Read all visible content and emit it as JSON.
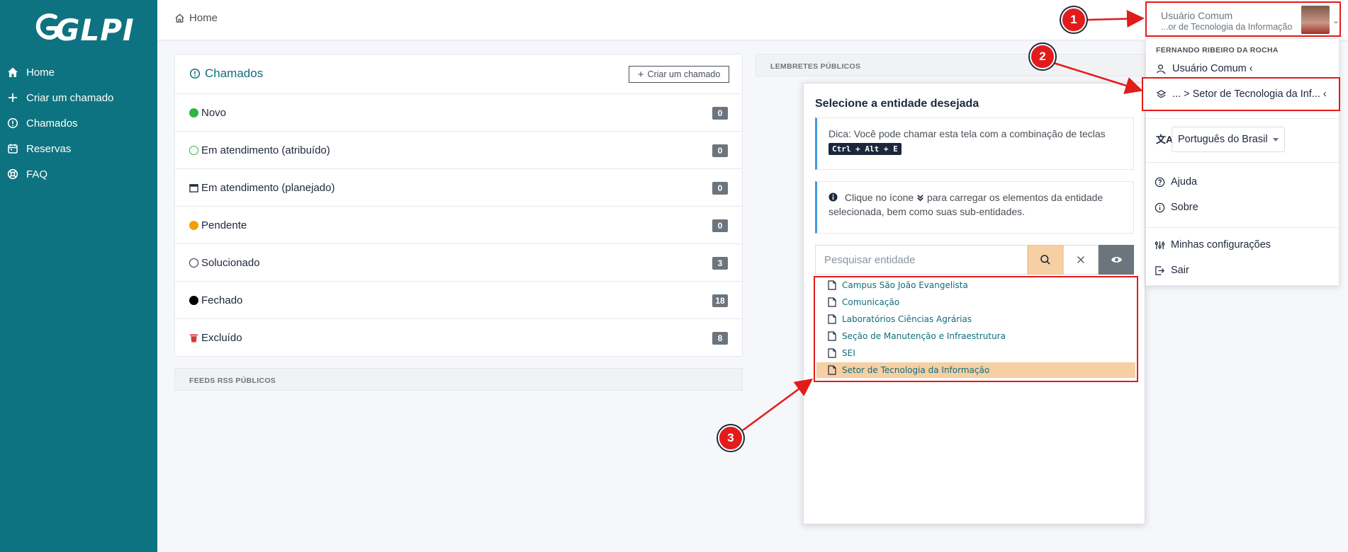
{
  "sidebar": {
    "logo": "GLPI",
    "items": [
      {
        "label": "Home",
        "icon": "home-icon"
      },
      {
        "label": "Criar um chamado",
        "icon": "plus-icon"
      },
      {
        "label": "Chamados",
        "icon": "alert-circle-icon"
      },
      {
        "label": "Reservas",
        "icon": "calendar-icon"
      },
      {
        "label": "FAQ",
        "icon": "lifebuoy-icon"
      }
    ]
  },
  "header": {
    "breadcrumb": "Home"
  },
  "user": {
    "profile": "Usuário Comum",
    "entity": "...or de Tecnologia da Informação"
  },
  "dropdown": {
    "user_fullname": "FERNANDO RIBEIRO DA ROCHA",
    "profile_label": "Usuário Comum",
    "entity_label": "... > Setor de Tecnologia da Inf...",
    "language": "Português do Brasil",
    "help": "Ajuda",
    "about": "Sobre",
    "settings": "Minhas configurações",
    "logout": "Sair"
  },
  "chamados": {
    "title": "Chamados",
    "create_button": "Criar um chamado",
    "statuses": [
      {
        "label": "Novo",
        "count": "0",
        "color": "#2fb344"
      },
      {
        "label": "Em atendimento (atribuído)",
        "count": "0",
        "color": "#2fb344"
      },
      {
        "label": "Em atendimento (planejado)",
        "count": "0",
        "color": "#1d273b"
      },
      {
        "label": "Pendente",
        "count": "0",
        "color": "#f59f00"
      },
      {
        "label": "Solucionado",
        "count": "3",
        "color": "#1d273b"
      },
      {
        "label": "Fechado",
        "count": "18",
        "color": "#000000"
      },
      {
        "label": "Excluído",
        "count": "8",
        "color": "#d63939"
      }
    ]
  },
  "feeds": {
    "title": "FEEDS RSS PÚBLICOS"
  },
  "lembretes": {
    "title": "LEMBRETES PÚBLICOS"
  },
  "entity_modal": {
    "title": "Selecione a entidade desejada",
    "tip_prefix": "Dica: Você pode chamar esta tela com a combinação de teclas",
    "tip_shortcut": "Ctrl + Alt + E",
    "info_prefix": "Clique no ícone",
    "info_suffix": "para carregar os elementos da entidade selecionada, bem como suas sub-entidades.",
    "search_placeholder": "Pesquisar entidade",
    "entities": [
      "Campus São João Evangelista",
      "Comunicação",
      "Laboratórios Ciências Agrárias",
      "Seção de Manutenção e Infraestrutura",
      "SEI",
      "Setor de Tecnologia da Informação"
    ],
    "selected_entity": "Setor de Tecnologia da Informação"
  },
  "markers": [
    "1",
    "2",
    "3"
  ],
  "colors": {
    "sidebar": "#0e7380",
    "accent": "#0e6e7c",
    "highlight": "#f6cfa3",
    "annotation": "#e21b1b"
  }
}
